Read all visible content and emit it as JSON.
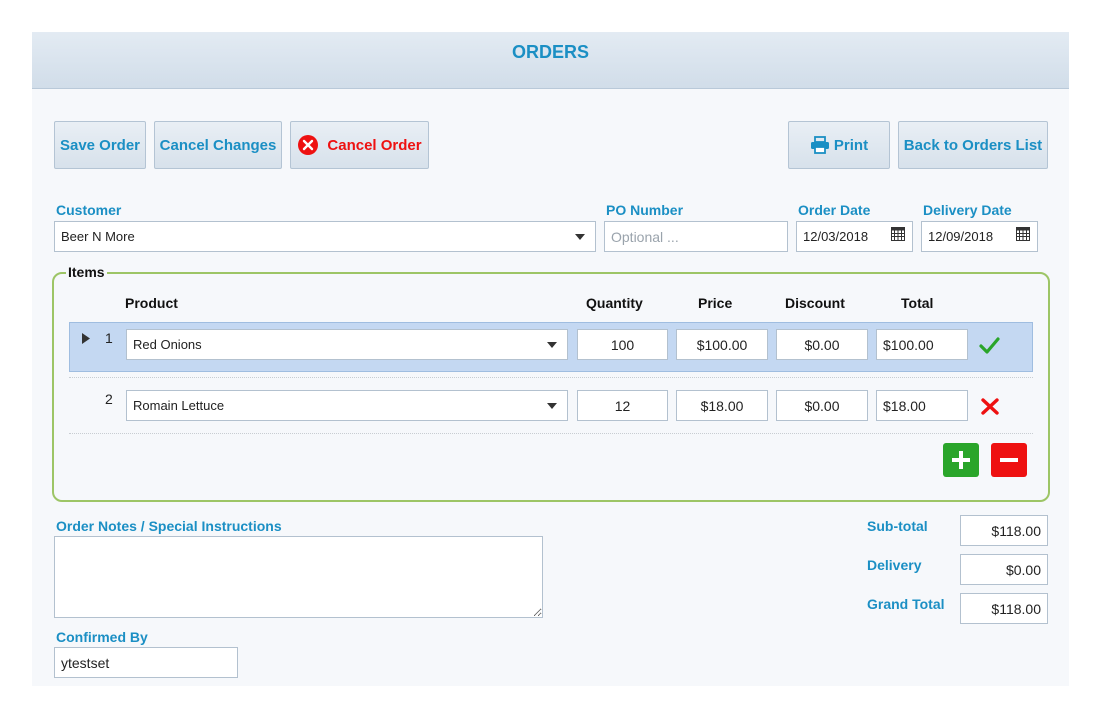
{
  "header": {
    "title": "ORDERS"
  },
  "toolbar": {
    "save_label": "Save Order",
    "cancel_changes_label": "Cancel Changes",
    "cancel_order_label": "Cancel Order",
    "print_label": "Print",
    "back_label": "Back to Orders List"
  },
  "order": {
    "customer_label": "Customer",
    "customer_value": "Beer N More",
    "po_label": "PO Number",
    "po_placeholder": "Optional ...",
    "order_date_label": "Order Date",
    "order_date_value": "12/03/2018",
    "delivery_date_label": "Delivery Date",
    "delivery_date_value": "12/09/2018"
  },
  "items": {
    "legend": "Items",
    "columns": {
      "product": "Product",
      "quantity": "Quantity",
      "price": "Price",
      "discount": "Discount",
      "total": "Total"
    },
    "rows": [
      {
        "num": "1",
        "product": "Red Onions",
        "quantity": "100",
        "price": "$100.00",
        "discount": "$0.00",
        "total": "$100.00",
        "status_icon": "check-icon"
      },
      {
        "num": "2",
        "product": "Romain Lettuce",
        "quantity": "12",
        "price": "$18.00",
        "discount": "$0.00",
        "total": "$18.00",
        "status_icon": "delete-icon"
      }
    ]
  },
  "notes": {
    "label": "Order Notes / Special Instructions",
    "value": ""
  },
  "confirmed": {
    "label": "Confirmed By",
    "value": "ytestset"
  },
  "totals": {
    "subtotal_label": "Sub-total",
    "subtotal_value": "$118.00",
    "delivery_label": "Delivery",
    "delivery_value": "$0.00",
    "grand_label": "Grand Total",
    "grand_value": "$118.00"
  },
  "colors": {
    "accent": "#1b8fc4",
    "add": "#2aa52a",
    "remove": "#ee1111",
    "border_green": "#9dc566"
  }
}
